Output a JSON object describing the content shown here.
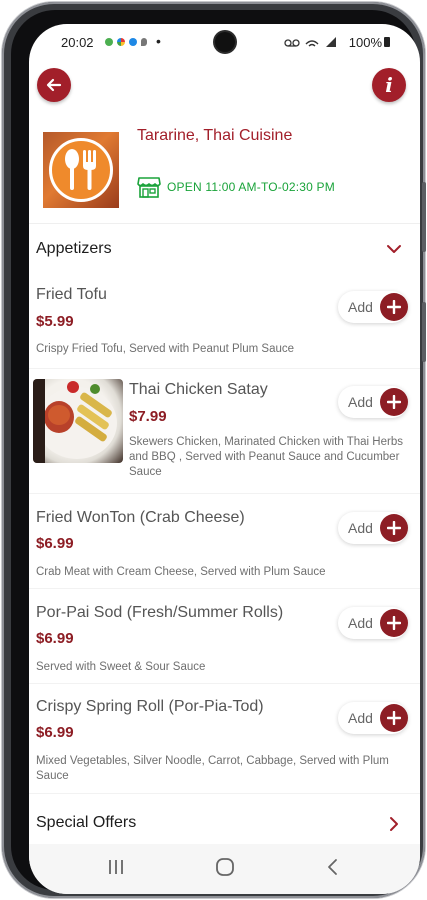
{
  "status_bar": {
    "time": "20:02",
    "dot": "•",
    "battery": "100%",
    "icons": [
      "voicemail-icon",
      "wifi-icon",
      "signal-icon",
      "battery-icon"
    ]
  },
  "app_bar": {
    "back_icon": "arrow-left-icon",
    "info_label": "i"
  },
  "restaurant": {
    "name": "Tararine, Thai Cuisine",
    "open_text": "OPEN 11:00 AM-TO-02:30 PM",
    "logo_icon": "spoon-fork-icon",
    "status_icon": "storefront-icon"
  },
  "sections": {
    "appetizers_title": "Appetizers",
    "special_offers_title": "Special Offers"
  },
  "add_label": "Add",
  "items": [
    {
      "name": "Fried Tofu",
      "price": "$5.99",
      "description": "Crispy Fried Tofu, Served with Peanut Plum Sauce"
    },
    {
      "name": "Thai Chicken Satay",
      "price": "$7.99",
      "description": "Skewers Chicken, Marinated Chicken with Thai Herbs and BBQ , Served with Peanut Sauce and Cucumber Sauce"
    },
    {
      "name": "Fried WonTon (Crab Cheese)",
      "price": "$6.99",
      "description": "Crab Meat with Cream Cheese, Served with Plum Sauce"
    },
    {
      "name": "Por-Pai Sod (Fresh/Summer Rolls)",
      "price": "$6.99",
      "description": "Served with Sweet & Sour Sauce"
    },
    {
      "name": "Crispy Spring Roll (Por-Pia-Tod)",
      "price": "$6.99",
      "description": "Mixed Vegetables, Silver Noodle, Carrot, Cabbage, Served with Plum Sauce"
    }
  ],
  "colors": {
    "brand": "#a21f2a",
    "price": "#8d1d24",
    "open_green": "#1aa33a"
  }
}
